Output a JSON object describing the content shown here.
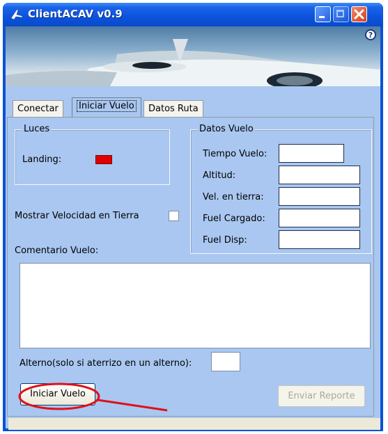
{
  "window": {
    "title": "ClientACAV v0.9",
    "help_glyph": "?"
  },
  "tabs": [
    {
      "label": "Conectar"
    },
    {
      "label": "Iniciar Vuelo"
    },
    {
      "label": "Datos Ruta"
    }
  ],
  "active_tab": "Iniciar Vuelo",
  "luces": {
    "title": "Luces",
    "landing_label": "Landing:",
    "landing_color": "#e00000"
  },
  "datos_vuelo": {
    "title": "Datos Vuelo",
    "fields": [
      {
        "label": "Tiempo Vuelo:",
        "value": ""
      },
      {
        "label": "Altitud:",
        "value": ""
      },
      {
        "label": "Vel. en tierra:",
        "value": ""
      },
      {
        "label": "Fuel Cargado:",
        "value": ""
      },
      {
        "label": "Fuel Disp:",
        "value": ""
      }
    ]
  },
  "mostrar_velocidad": {
    "label": "Mostrar Velocidad en Tierra",
    "checked": false
  },
  "comentario": {
    "label": "Comentario Vuelo:",
    "value": ""
  },
  "alterno": {
    "label": "Alterno(solo si aterrizo en un alterno):",
    "value": ""
  },
  "buttons": {
    "iniciar": "Iniciar Vuelo",
    "enviar": "Enviar Reporte"
  },
  "colors": {
    "titlebar_blue": "#0a52d8",
    "client_blue": "#a9c7f0",
    "annotation_red": "#e0101a"
  }
}
